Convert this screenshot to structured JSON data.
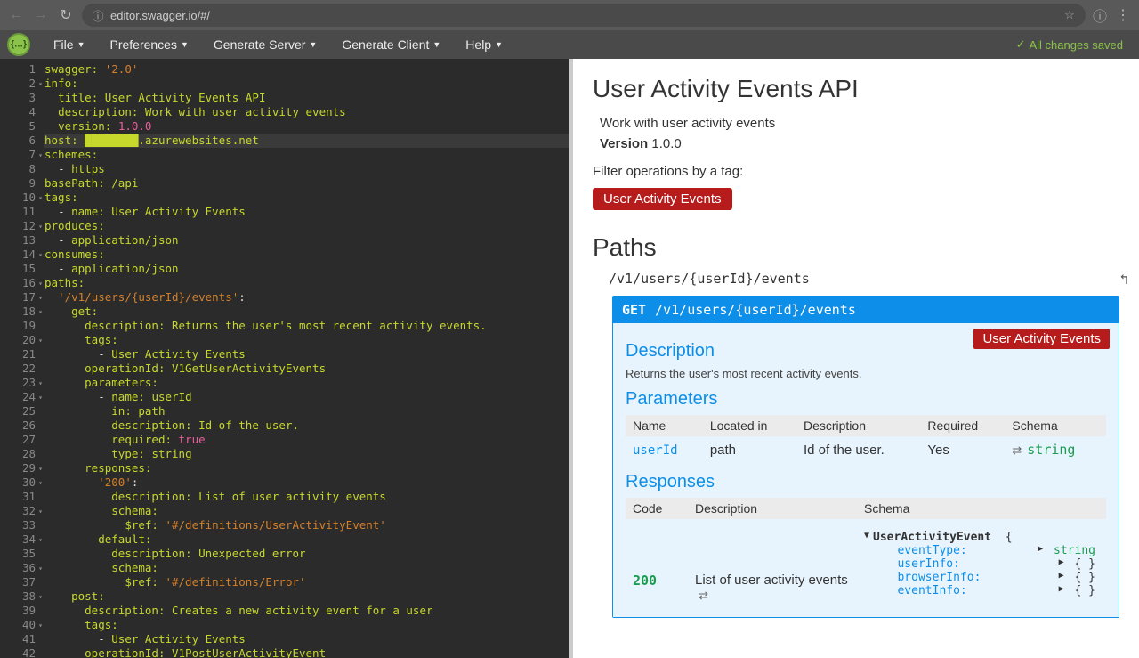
{
  "browser": {
    "url": "editor.swagger.io/#/",
    "back_icon": "←",
    "forward_icon": "→",
    "reload_icon": "↻",
    "info_icon": "ⓘ",
    "star_icon": "☆",
    "menu_icon": "⋮"
  },
  "menu": {
    "items": [
      "File",
      "Preferences",
      "Generate Server",
      "Generate Client",
      "Help"
    ],
    "save_status": "All changes saved",
    "check_icon": "✓"
  },
  "editor": {
    "lines": [
      {
        "n": 1,
        "html": "<span class='k'>swagger:</span> <span class='v'>'2.0'</span>"
      },
      {
        "n": 2,
        "fold": "▾",
        "html": "<span class='k'>info:</span>"
      },
      {
        "n": 3,
        "html": "  <span class='k'>title:</span> <span class='s'>User Activity Events API</span>"
      },
      {
        "n": 4,
        "html": "  <span class='k'>description:</span> <span class='s'>Work with user activity events</span>"
      },
      {
        "n": 5,
        "html": "  <span class='k'>version:</span> <span class='n'>1.0.0</span>"
      },
      {
        "n": 6,
        "cur": true,
        "html": "<span class='k'>host:</span> <span class='s'>████████.azurewebsites.net</span>"
      },
      {
        "n": 7,
        "fold": "▾",
        "html": "<span class='k'>schemes:</span>"
      },
      {
        "n": 8,
        "html": "  <span class='p'>-</span> <span class='s'>https</span>"
      },
      {
        "n": 9,
        "html": "<span class='k'>basePath:</span> <span class='s'>/api</span>"
      },
      {
        "n": 10,
        "fold": "▾",
        "html": "<span class='k'>tags:</span>"
      },
      {
        "n": 11,
        "html": "  <span class='p'>-</span> <span class='k'>name:</span> <span class='s'>User Activity Events</span>"
      },
      {
        "n": 12,
        "fold": "▾",
        "html": "<span class='k'>produces:</span>"
      },
      {
        "n": 13,
        "html": "  <span class='p'>-</span> <span class='s'>application/json</span>"
      },
      {
        "n": 14,
        "fold": "▾",
        "html": "<span class='k'>consumes:</span>"
      },
      {
        "n": 15,
        "html": "  <span class='p'>-</span> <span class='s'>application/json</span>"
      },
      {
        "n": 16,
        "fold": "▾",
        "html": "<span class='k'>paths:</span>"
      },
      {
        "n": 17,
        "fold": "▾",
        "html": "  <span class='v'>'/v1/users/{userId}/events'</span><span class='p'>:</span>"
      },
      {
        "n": 18,
        "fold": "▾",
        "html": "    <span class='k'>get:</span>"
      },
      {
        "n": 19,
        "html": "      <span class='k'>description:</span> <span class='s'>Returns the user's most recent activity events.</span>"
      },
      {
        "n": 20,
        "fold": "▾",
        "html": "      <span class='k'>tags:</span>"
      },
      {
        "n": 21,
        "html": "        <span class='p'>-</span> <span class='s'>User Activity Events</span>"
      },
      {
        "n": 22,
        "html": "      <span class='k'>operationId:</span> <span class='s'>V1GetUserActivityEvents</span>"
      },
      {
        "n": 23,
        "fold": "▾",
        "html": "      <span class='k'>parameters:</span>"
      },
      {
        "n": 24,
        "fold": "▾",
        "html": "        <span class='p'>-</span> <span class='k'>name:</span> <span class='s'>userId</span>"
      },
      {
        "n": 25,
        "html": "          <span class='k'>in:</span> <span class='s'>path</span>"
      },
      {
        "n": 26,
        "html": "          <span class='k'>description:</span> <span class='s'>Id of the user.</span>"
      },
      {
        "n": 27,
        "html": "          <span class='k'>required:</span> <span class='b'>true</span>"
      },
      {
        "n": 28,
        "html": "          <span class='k'>type:</span> <span class='s'>string</span>"
      },
      {
        "n": 29,
        "fold": "▾",
        "html": "      <span class='k'>responses:</span>"
      },
      {
        "n": 30,
        "fold": "▾",
        "html": "        <span class='v'>'200'</span><span class='p'>:</span>"
      },
      {
        "n": 31,
        "html": "          <span class='k'>description:</span> <span class='s'>List of user activity events</span>"
      },
      {
        "n": 32,
        "fold": "▾",
        "html": "          <span class='k'>schema:</span>"
      },
      {
        "n": 33,
        "html": "            <span class='k'>$ref:</span> <span class='v'>'#/definitions/UserActivityEvent'</span>"
      },
      {
        "n": 34,
        "fold": "▾",
        "html": "        <span class='k'>default:</span>"
      },
      {
        "n": 35,
        "html": "          <span class='k'>description:</span> <span class='s'>Unexpected error</span>"
      },
      {
        "n": 36,
        "fold": "▾",
        "html": "          <span class='k'>schema:</span>"
      },
      {
        "n": 37,
        "html": "            <span class='k'>$ref:</span> <span class='v'>'#/definitions/Error'</span>"
      },
      {
        "n": 38,
        "fold": "▾",
        "html": "    <span class='k'>post:</span>"
      },
      {
        "n": 39,
        "html": "      <span class='k'>description:</span> <span class='s'>Creates a new activity event for a user</span>"
      },
      {
        "n": 40,
        "fold": "▾",
        "html": "      <span class='k'>tags:</span>"
      },
      {
        "n": 41,
        "html": "        <span class='p'>-</span> <span class='s'>User Activity Events</span>"
      },
      {
        "n": 42,
        "html": "      <span class='k'>operationId:</span> <span class='s'>V1PostUserActivityEvent</span>"
      }
    ]
  },
  "preview": {
    "title": "User Activity Events API",
    "description": "Work with user activity events",
    "version_label": "Version",
    "version": "1.0.0",
    "filter_label": "Filter operations by a tag:",
    "tag": "User Activity Events",
    "paths_heading": "Paths",
    "path": "/v1/users/{userId}/events",
    "collapse_icon": "↰",
    "op": {
      "method": "GET",
      "path": "/v1/users/{userId}/events",
      "tag": "User Activity Events",
      "desc_heading": "Description",
      "description": "Returns the user's most recent activity events.",
      "params_heading": "Parameters",
      "param_headers": [
        "Name",
        "Located in",
        "Description",
        "Required",
        "Schema"
      ],
      "param": {
        "name": "userId",
        "in": "path",
        "desc": "Id of the user.",
        "required": "Yes",
        "type": "string",
        "swap": "⇄"
      },
      "resp_heading": "Responses",
      "resp_headers": [
        "Code",
        "Description",
        "Schema"
      ],
      "resp": {
        "code": "200",
        "desc": "List of user activity events",
        "swap": "⇄"
      },
      "schema": {
        "name": "UserActivityEvent",
        "open": "{",
        "props": [
          {
            "key": "eventType:",
            "val": "string",
            "tri": "▶"
          },
          {
            "key": "userInfo:",
            "val": "{ }",
            "tri": "▶"
          },
          {
            "key": "browserInfo:",
            "val": "{ }",
            "tri": "▶"
          },
          {
            "key": "eventInfo:",
            "val": "{ }",
            "tri": "▶"
          }
        ],
        "tri_open": "▼"
      }
    }
  }
}
